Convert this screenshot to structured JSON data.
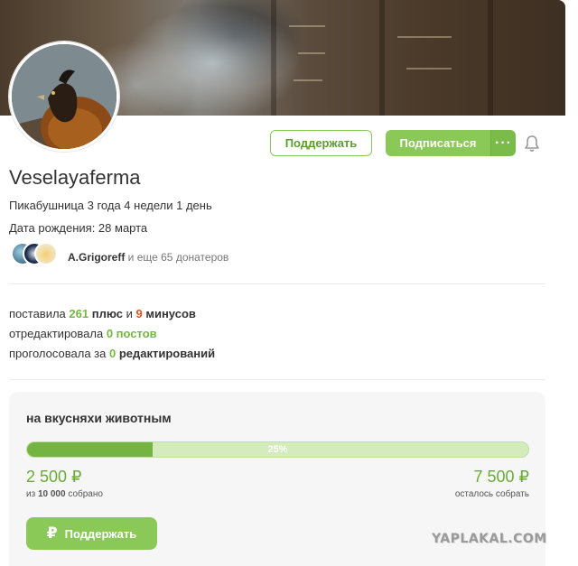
{
  "profile": {
    "username": "Veselayaferma",
    "tenure": "Пикабушница 3 года 4 недели 1 день",
    "birthday": "Дата рождения: 28 марта",
    "donors_name": "A.Grigoreff",
    "donors_rest": " и еще 65 донатеров"
  },
  "actions": {
    "support_label": "Поддержать",
    "subscribe_label": "Подписаться",
    "more_label": "···"
  },
  "stats": {
    "line1_prefix": "поставила ",
    "pluses": "261",
    "line1_mid": " плюс",
    "line1_and": " и ",
    "minuses": "9",
    "line1_suffix": " минусов",
    "line2_prefix": "отредактировала ",
    "edited_posts": "0",
    "line2_suffix": " постов",
    "line3_prefix": "проголосовала за ",
    "voted_edits": "0",
    "line3_suffix": " редактирований"
  },
  "fundraiser": {
    "title": "на вкусняхи животным",
    "progress_percent": 25,
    "progress_label": "25%",
    "collected": "2 500 ₽",
    "collected_sub_prefix": "из ",
    "goal": "10 000",
    "collected_sub_suffix": " собрано",
    "remaining": "7 500 ₽",
    "remaining_sub": "осталось собрать",
    "donate_label": "Поддержать"
  },
  "watermark": "YAPLAKAL.COM",
  "colors": {
    "accent_green": "#8ac858",
    "text_green": "#76b544",
    "minus_red": "#e2521d"
  }
}
